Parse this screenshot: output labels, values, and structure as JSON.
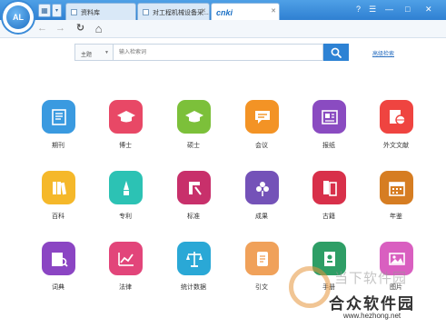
{
  "window": {
    "tabs": [
      {
        "label": "资料库"
      },
      {
        "label": "对工程机械设备采..."
      },
      {
        "label": "cnki"
      }
    ],
    "controls": {
      "help": "?",
      "settings": "☰",
      "minimize": "—",
      "maximize": "□",
      "close": "✕"
    }
  },
  "nav": {
    "back": "←",
    "forward": "→",
    "refresh": "↻",
    "home": "⌂"
  },
  "search": {
    "scope_value": "主题",
    "placeholder": "输入检索词",
    "advanced_label": "高级检索"
  },
  "categories": [
    {
      "label": "期刊",
      "color": "#3a9ae0",
      "icon": "journal-icon"
    },
    {
      "label": "博士",
      "color": "#e84866",
      "icon": "graduation-cap-icon"
    },
    {
      "label": "硕士",
      "color": "#7cc03a",
      "icon": "graduation-cap-icon"
    },
    {
      "label": "会议",
      "color": "#f39325",
      "icon": "chat-bubble-icon"
    },
    {
      "label": "报纸",
      "color": "#8a4bc1",
      "icon": "newspaper-icon"
    },
    {
      "label": "外文文献",
      "color": "#ef4440",
      "icon": "foreign-docs-icon"
    },
    {
      "label": "百科",
      "color": "#f5b82a",
      "icon": "books-icon"
    },
    {
      "label": "专利",
      "color": "#2cc2b4",
      "icon": "patent-icon"
    },
    {
      "label": "标准",
      "color": "#c8306b",
      "icon": "standard-icon"
    },
    {
      "label": "成果",
      "color": "#7452b8",
      "icon": "achievement-icon"
    },
    {
      "label": "古籍",
      "color": "#d8304a",
      "icon": "ancient-book-icon"
    },
    {
      "label": "年鉴",
      "color": "#d67d22",
      "icon": "calendar-icon"
    },
    {
      "label": "词典",
      "color": "#8b45c3",
      "icon": "dictionary-icon"
    },
    {
      "label": "法律",
      "color": "#e2457a",
      "icon": "chart-icon"
    },
    {
      "label": "统计数据",
      "color": "#2aa8d6",
      "icon": "scales-icon"
    },
    {
      "label": "引文",
      "color": "#f0a15a",
      "icon": "scroll-icon"
    },
    {
      "label": "手册",
      "color": "#2e9e66",
      "icon": "handbook-icon"
    },
    {
      "label": "图片",
      "color": "#d95fc0",
      "icon": "picture-icon"
    }
  ],
  "watermark": {
    "top": "当下软件园",
    "main": "合众软件园",
    "url": "www.hezhong.net"
  }
}
